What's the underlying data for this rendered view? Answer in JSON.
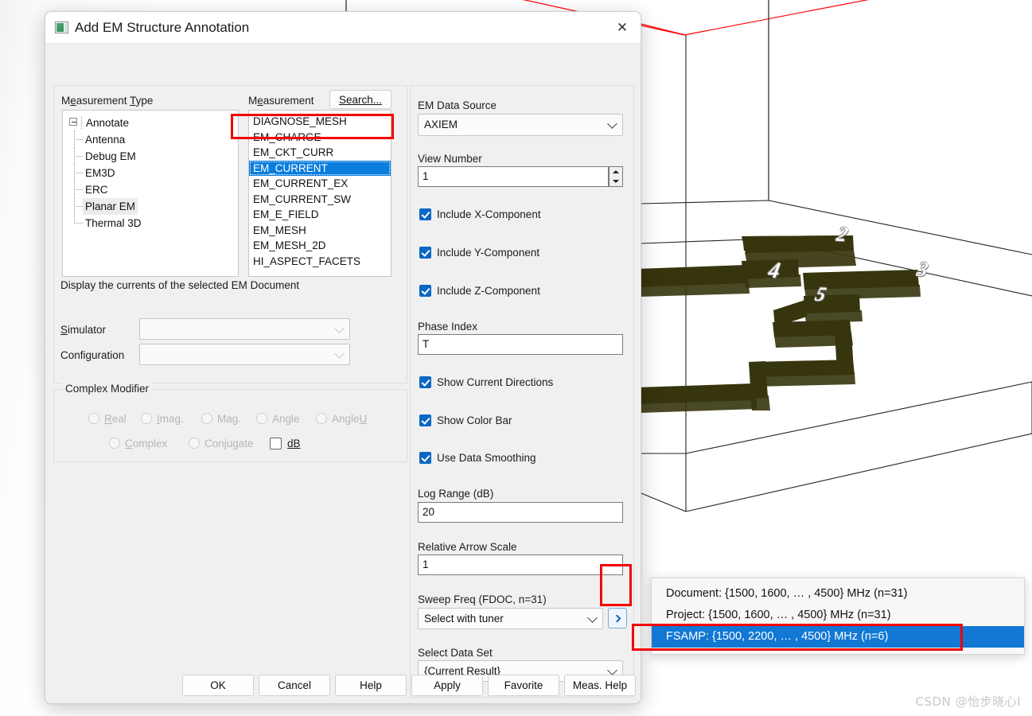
{
  "window": {
    "title": "Add EM Structure Annotation",
    "icon": "image-icon",
    "close_label": "✕"
  },
  "measurement_type": {
    "label": "Measurement Type",
    "tree": [
      {
        "label": "Annotate",
        "level": 0,
        "expanded": true
      },
      {
        "label": "Antenna",
        "level": 1
      },
      {
        "label": "Debug EM",
        "level": 1
      },
      {
        "label": "EM3D",
        "level": 1
      },
      {
        "label": "ERC",
        "level": 1
      },
      {
        "label": "Planar EM",
        "level": 1,
        "selected": true
      },
      {
        "label": "Thermal 3D",
        "level": 1,
        "last": true
      }
    ]
  },
  "measurement": {
    "label": "Measurement",
    "search_button": "Search...",
    "items": [
      "DIAGNOSE_MESH",
      "EM_CHARGE",
      "EM_CKT_CURR",
      "EM_CURRENT",
      "EM_CURRENT_EX",
      "EM_CURRENT_SW",
      "EM_E_FIELD",
      "EM_MESH",
      "EM_MESH_2D",
      "HI_ASPECT_FACETS"
    ],
    "selected": "EM_CURRENT"
  },
  "description": "Display the currents of the selected EM Document",
  "simulator": {
    "label": "Simulator",
    "value": ""
  },
  "configuration": {
    "label": "Configuration",
    "value": ""
  },
  "complex_modifier": {
    "label": "Complex Modifier",
    "radios_row1": [
      "Real",
      "Imag.",
      "Mag.",
      "Angle",
      "AngleU"
    ],
    "radios_row2": [
      "Complex",
      "Conjugate"
    ],
    "db_checkbox": "dB",
    "db_checked": false
  },
  "right_panel": {
    "em_data_source": {
      "label": "EM Data Source",
      "value": "AXIEM"
    },
    "view_number": {
      "label": "View Number",
      "value": "1"
    },
    "include_x": {
      "label": "Include X-Component",
      "checked": true
    },
    "include_y": {
      "label": "Include Y-Component",
      "checked": true
    },
    "include_z": {
      "label": "Include Z-Component",
      "checked": true
    },
    "phase_index": {
      "label": "Phase Index",
      "value": "T"
    },
    "show_current_directions": {
      "label": "Show Current Directions",
      "checked": true
    },
    "show_color_bar": {
      "label": "Show Color Bar",
      "checked": true
    },
    "use_data_smoothing": {
      "label": "Use Data Smoothing",
      "checked": true
    },
    "log_range": {
      "label": "Log Range (dB)",
      "value": "20"
    },
    "relative_arrow_scale": {
      "label": "Relative Arrow Scale",
      "value": "1"
    },
    "sweep_freq": {
      "label": "Sweep Freq  (FDOC, n=31)",
      "value": "Select with tuner",
      "arrow_button": "›"
    },
    "select_data_set": {
      "label": "Select Data Set",
      "value": "{Current Result}"
    }
  },
  "freq_popup": {
    "items": [
      {
        "text": "Document: {1500, 1600, … , 4500} MHz  (n=31)",
        "selected": false
      },
      {
        "text": "Project: {1500, 1600, … , 4500} MHz  (n=31)",
        "selected": false
      },
      {
        "text": "FSAMP: {1500, 2200, … , 4500} MHz  (n=6)",
        "selected": true
      }
    ]
  },
  "buttons": [
    "OK",
    "Cancel",
    "Help",
    "Apply",
    "Favorite",
    "Meas. Help"
  ],
  "viewer": {
    "port_labels": [
      "2",
      "3",
      "4",
      "5"
    ],
    "trace_color": "#36350d",
    "boundary_color": "#ff0000"
  },
  "watermark": "CSDN @怡步晓心I",
  "colors": {
    "accent_blue": "#0a7ddd",
    "highlight_red": "#f40000",
    "checkbox_blue": "#0a68c4"
  }
}
